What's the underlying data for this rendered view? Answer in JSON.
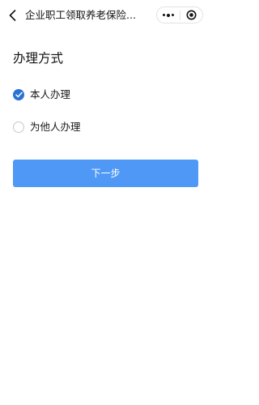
{
  "navbar": {
    "title": "企业职工领取养老保险...",
    "icons": {
      "back": "chevron-left-icon",
      "more": "more-dots-icon",
      "close": "close-circle-icon"
    }
  },
  "section": {
    "title": "办理方式"
  },
  "options": [
    {
      "label": "本人办理",
      "checked": true
    },
    {
      "label": "为他人办理",
      "checked": false
    }
  ],
  "actions": {
    "next_label": "下一步"
  },
  "colors": {
    "accent": "#2b72d6",
    "button": "#4f98f6",
    "button_text": "#ffffff"
  }
}
